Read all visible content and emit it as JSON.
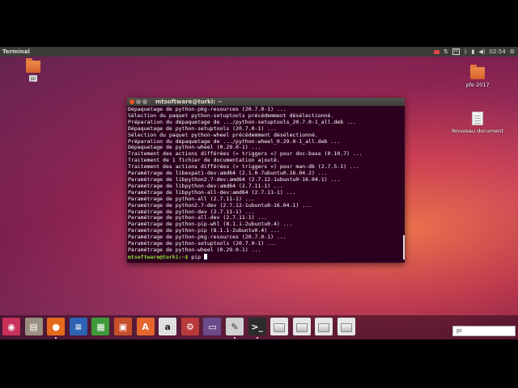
{
  "panel": {
    "title": "Terminal",
    "clock": "02:54",
    "keyboard": "Fr"
  },
  "desktop": {
    "icons": [
      {
        "label": "pi"
      },
      {
        "label": "pfe 2017"
      },
      {
        "label": "Nouveau document"
      }
    ]
  },
  "terminal": {
    "title": "mtsoftware@turki: ~",
    "lines": [
      "Dépaquetage de python-pkg-resources (20.7.0-1) ...",
      "Sélection du paquet python-setuptools précédemment désélectionné.",
      "Préparation du dépaquetage de .../python-setuptools_20.7.0-1_all.deb ...",
      "Dépaquetage de python-setuptools (20.7.0-1) ...",
      "Sélection du paquet python-wheel précédemment désélectionné.",
      "Préparation du dépaquetage de .../python-wheel_0.29.0-1_all.deb ...",
      "Dépaquetage de python-wheel (0.29.0-1) ...",
      "Traitement des actions différées (« triggers ») pour doc-base (0.10.7) ...",
      "Traitement de 1 fichier de documentation ajouté.",
      "Traitement des actions différées (« triggers ») pour man-db (2.7.5-1) ...",
      "Paramétrage de libexpat1-dev:amd64 (2.1.0-7ubuntu0.16.04.2) ...",
      "Paramétrage de libpython2.7-dev:amd64 (2.7.12-1ubuntu0-16.04.1) ...",
      "Paramétrage de libpython-dev:amd64 (2.7.11-1) ...",
      "Paramétrage de libpython-all-dev:amd64 (2.7.11-1) ...",
      "Paramétrage de python-all (2.7.11-1) ...",
      "Paramétrage de python2.7-dev (2.7.12-1ubuntu0-16.04.1) ...",
      "Paramétrage de python-dev (2.7.11-1) ...",
      "Paramétrage de python-all-dev (2.7.11-1) ...",
      "Paramétrage de python-pip-whl (8.1.1-2ubuntu0.4) ...",
      "Paramétrage de python-pip (8.1.1-2ubuntu0.4) ...",
      "Paramétrage de python-pkg-resources (20.7.0-1) ...",
      "Paramétrage de python-setuptools (20.7.0-1) ...",
      "Paramétrage de python-wheel (0.29.0-1) ..."
    ],
    "prompt": "mtsoftware@turki:~$",
    "command": " pip "
  },
  "launcher": {
    "items": [
      {
        "name": "ubuntu-dash",
        "glyph": "◉",
        "color": "#c9305a"
      },
      {
        "name": "files",
        "glyph": "▤",
        "color": "#9a8f80"
      },
      {
        "name": "firefox",
        "glyph": "●",
        "color": "#e56a1d"
      },
      {
        "name": "writer",
        "glyph": "≡",
        "color": "#2e62b4"
      },
      {
        "name": "calc",
        "glyph": "▦",
        "color": "#3f9a3a"
      },
      {
        "name": "impress",
        "glyph": "▣",
        "color": "#c5502a"
      },
      {
        "name": "software-center",
        "glyph": "A",
        "color": "#e4662c"
      },
      {
        "name": "amazon",
        "glyph": "a",
        "color": "#e0e0e0"
      },
      {
        "name": "system-settings",
        "glyph": "⚙",
        "color": "#b83a3a"
      },
      {
        "name": "monitor",
        "glyph": "▭",
        "color": "#6b4a8a"
      },
      {
        "name": "text-editor",
        "glyph": "✎",
        "color": "#cfcfcf"
      },
      {
        "name": "terminal",
        "glyph": ">_",
        "color": "#2b2b2b"
      },
      {
        "name": "drive-1",
        "glyph": "",
        "color": "#e6e6e6"
      },
      {
        "name": "drive-2",
        "glyph": "",
        "color": "#e6e6e6"
      },
      {
        "name": "drive-3",
        "glyph": "",
        "color": "#e6e6e6"
      },
      {
        "name": "drive-4",
        "glyph": "",
        "color": "#e6e6e6"
      }
    ]
  },
  "search": {
    "value": "pi"
  }
}
